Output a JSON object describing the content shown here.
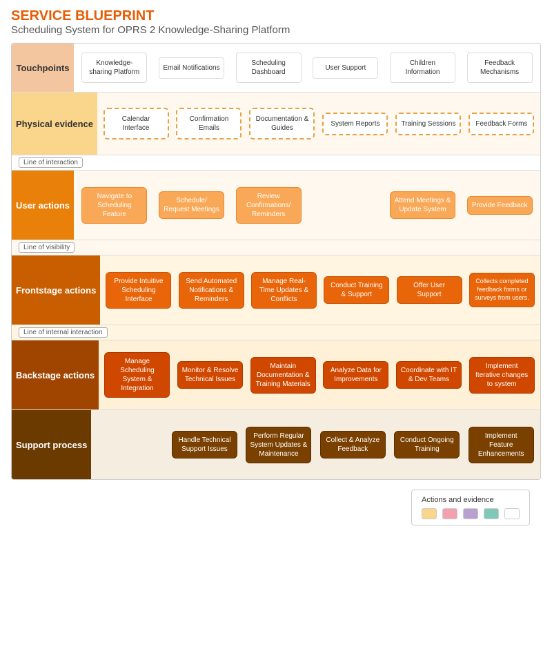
{
  "title": {
    "main": "SERVICE BLUEPRINT",
    "sub": "Scheduling System for OPRS 2 Knowledge-Sharing Platform"
  },
  "rows": {
    "touchpoints": {
      "label": "Touchpoints",
      "items": [
        "Knowledge-sharing Platform",
        "Email Notifications",
        "Scheduling Dashboard",
        "User Support",
        "Children Information",
        "Feedback Mechanisms"
      ]
    },
    "physical": {
      "label": "Physical evidence",
      "items": [
        "Calendar Interface",
        "Confirmation Emails",
        "Documentation & Guides",
        "System Reports",
        "Training Sessions",
        "Feedback Forms"
      ]
    },
    "user": {
      "label": "User actions",
      "items": [
        "Navigate to Scheduling Feature",
        "Schedule/ Request Meetings",
        "Review Confirmations/ Reminders",
        "",
        "Attend Meetings & Update System",
        "Provide Feedback"
      ]
    },
    "frontstage": {
      "label": "Frontstage actions",
      "items": [
        "Provide Intuitive Scheduling Interface",
        "Send Automated Notifications & Reminders",
        "Manage Real-Time Updates & Conflicts",
        "Conduct Training & Support",
        "Offer User Support",
        "Collects completed feedback forms or surveys from users."
      ]
    },
    "backstage": {
      "label": "Backstage actions",
      "items": [
        "Manage Scheduling System & Integration",
        "Monitor & Resolve Technical Issues",
        "Maintain Documentation & Training Materials",
        "Analyze Data for Improvements",
        "Coordinate with IT & Dev Teams",
        "Implement Iterative changes to system"
      ]
    },
    "support": {
      "label": "Support process",
      "items": [
        "",
        "Handle Technical Support Issues",
        "Perform Regular System Updates & Maintenance",
        "Collect & Analyze Feedback",
        "Conduct Ongoing Training",
        "Implement Feature Enhancements"
      ]
    }
  },
  "lines": {
    "interaction": "Line of interaction",
    "visibility": "Line of visibility",
    "internal": "Line of internal interaction"
  },
  "legend": {
    "title": "Actions and evidence",
    "swatches": [
      {
        "color": "#f9d68c",
        "label": ""
      },
      {
        "color": "#f4a0b0",
        "label": ""
      },
      {
        "color": "#b8a0d0",
        "label": ""
      },
      {
        "color": "#80c8b8",
        "label": ""
      },
      {
        "color": "#ffffff",
        "label": ""
      }
    ]
  }
}
